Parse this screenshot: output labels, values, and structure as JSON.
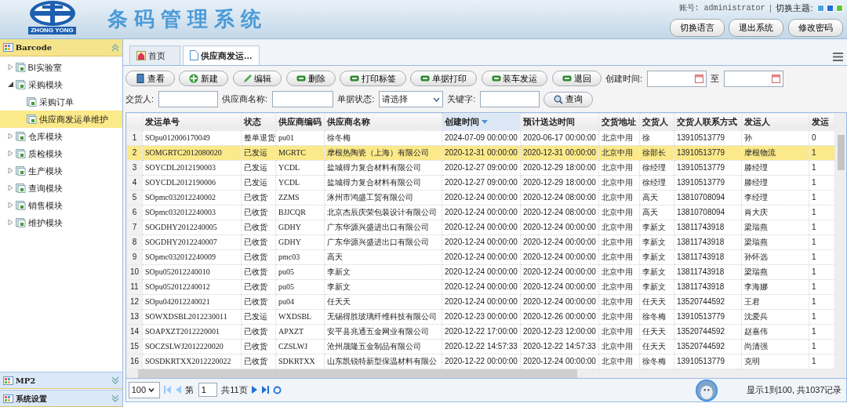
{
  "header": {
    "logo_text": "ZHONG YONG",
    "title": "条码管理系统",
    "account": "账号: administrator",
    "separator": "|",
    "theme_label": "切换主题:",
    "themes": [
      {
        "color": "#4aa3e0"
      },
      {
        "color": "#1e6fd9"
      },
      {
        "color": "#5cc83a"
      }
    ],
    "buttons": [
      "切换语言",
      "退出系统",
      "修改密码"
    ]
  },
  "sidebar": {
    "panels": [
      {
        "title": "Barcode",
        "expanded": true,
        "items": [
          {
            "label": "BI实验室",
            "kind": "folder",
            "expanded": false,
            "selected": false
          },
          {
            "label": "采购模块",
            "kind": "folder",
            "expanded": true,
            "selected": false,
            "children": [
              {
                "label": "采购订单",
                "kind": "leaf",
                "selected": false
              },
              {
                "label": "供应商发运单维护",
                "kind": "leaf",
                "selected": true
              }
            ]
          },
          {
            "label": "仓库模块",
            "kind": "folder",
            "expanded": false,
            "selected": false
          },
          {
            "label": "质检模块",
            "kind": "folder",
            "expanded": false,
            "selected": false
          },
          {
            "label": "生产模块",
            "kind": "folder",
            "expanded": false,
            "selected": false
          },
          {
            "label": "查询模块",
            "kind": "folder",
            "expanded": false,
            "selected": false
          },
          {
            "label": "销售模块",
            "kind": "folder",
            "expanded": false,
            "selected": false
          },
          {
            "label": "维护模块",
            "kind": "folder",
            "expanded": false,
            "selected": false
          }
        ]
      },
      {
        "title": "MP2",
        "expanded": false
      },
      {
        "title": "系统设置",
        "expanded": false
      }
    ]
  },
  "tabs": [
    {
      "label": "首页",
      "kind": "home",
      "selected": false
    },
    {
      "label": "供应商发运…",
      "kind": "page",
      "selected": true
    }
  ],
  "toolbar": {
    "buttons": [
      {
        "label": "查看",
        "kind": "view"
      },
      {
        "label": "新建",
        "kind": "add"
      },
      {
        "label": "编辑",
        "kind": "edit"
      },
      {
        "label": "删除",
        "kind": "bar"
      },
      {
        "label": "打印标签",
        "kind": "bar"
      },
      {
        "label": "单据打印",
        "kind": "bar"
      },
      {
        "label": "装车发运",
        "kind": "bar"
      },
      {
        "label": "退回",
        "kind": "bar"
      }
    ],
    "created_label": "创建时间:",
    "to_label": "至"
  },
  "filters": {
    "deliverer_label": "交货人:",
    "supplier_label": "供应商名称:",
    "status_label": "单据状态:",
    "status_value": "请选择",
    "keyword_label": "关键字:",
    "query_button": "查询"
  },
  "table": {
    "columns": [
      {
        "label": "发运单号",
        "sorted": false
      },
      {
        "label": "状态",
        "sorted": false
      },
      {
        "label": "供应商编码",
        "sorted": false
      },
      {
        "label": "供应商名称",
        "sorted": false
      },
      {
        "label": "创建时间",
        "sorted": true
      },
      {
        "label": "预计送达时间",
        "sorted": false
      },
      {
        "label": "交货地址",
        "sorted": false
      },
      {
        "label": "交货人",
        "sorted": false
      },
      {
        "label": "交货人联系方式",
        "sorted": false
      },
      {
        "label": "发运人",
        "sorted": false
      },
      {
        "label": "发运",
        "sorted": false
      }
    ],
    "rows": [
      {
        "selected": false,
        "number": "1",
        "cells": [
          "SOpu012006170049",
          "整单退货",
          "pu01",
          "徐冬梅",
          "2024-07-09 00:00:00",
          "2020-06-17 00:00:00",
          "北京中用",
          "徐",
          "13910513779",
          "孙",
          "0"
        ]
      },
      {
        "selected": true,
        "number": "2",
        "cells": [
          "SOMGRTC2012080020",
          "已发运",
          "MGRTC",
          "摩根热陶瓷（上海）有限公司",
          "2020-12-31 00:00:00",
          "2020-12-31 00:00:00",
          "北京中用",
          "徐部长",
          "13910513779",
          "摩根物流",
          "1"
        ]
      },
      {
        "selected": false,
        "number": "3",
        "cells": [
          "SOYCDL2012190003",
          "已发运",
          "YCDL",
          "盐城得力复合材料有限公司",
          "2020-12-27 09:00:00",
          "2020-12-29 18:00:00",
          "北京中用",
          "徐经理",
          "13910513779",
          "滕经理",
          "1"
        ]
      },
      {
        "selected": false,
        "number": "4",
        "cells": [
          "SOYCDL2012190006",
          "已发运",
          "YCDL",
          "盐城得力复合材料有限公司",
          "2020-12-27 09:00:00",
          "2020-12-29 18:00:00",
          "北京中用",
          "徐经理",
          "13910513779",
          "滕经理",
          "1"
        ]
      },
      {
        "selected": false,
        "number": "5",
        "cells": [
          "SOpmc032012240002",
          "已收货",
          "ZZMS",
          "涿州市鸿盛工贸有限公司",
          "2020-12-24 00:00:00",
          "2020-12-24 08:00:00",
          "北京中用",
          "高天",
          "13810708094",
          "李经理",
          "1"
        ]
      },
      {
        "selected": false,
        "number": "6",
        "cells": [
          "SOpmc032012240003",
          "已收货",
          "BJJCQR",
          "北京杰辰庆荣包装设计有限公司",
          "2020-12-24 00:00:00",
          "2020-12-24 08:00:00",
          "北京中用",
          "高天",
          "13810708094",
          "肖大庆",
          "1"
        ]
      },
      {
        "selected": false,
        "number": "7",
        "cells": [
          "SOGDHY2012240005",
          "已收货",
          "GDHY",
          "广东华源兴盛进出口有限公司",
          "2020-12-24 00:00:00",
          "2020-12-24 00:00:00",
          "北京中用",
          "李新文",
          "13811743918",
          "梁瑞燕",
          "1"
        ]
      },
      {
        "selected": false,
        "number": "8",
        "cells": [
          "SOGDHY2012240007",
          "已收货",
          "GDHY",
          "广东华源兴盛进出口有限公司",
          "2020-12-24 00:00:00",
          "2020-12-24 00:00:00",
          "北京中用",
          "李新文",
          "13811743918",
          "梁瑞燕",
          "1"
        ]
      },
      {
        "selected": false,
        "number": "9",
        "cells": [
          "SOpmc032012240009",
          "已收货",
          "pmc03",
          "高天",
          "2020-12-24 00:00:00",
          "2020-12-24 00:00:00",
          "北京中用",
          "李新文",
          "13811743918",
          "孙怀选",
          "1"
        ]
      },
      {
        "selected": false,
        "number": "10",
        "cells": [
          "SOpu052012240010",
          "已收货",
          "pu05",
          "李新文",
          "2020-12-24 00:00:00",
          "2020-12-24 00:00:00",
          "北京中用",
          "李新文",
          "13811743918",
          "梁瑞燕",
          "1"
        ]
      },
      {
        "selected": false,
        "number": "11",
        "cells": [
          "SOpu052012240012",
          "已收货",
          "pu05",
          "李新文",
          "2020-12-24 00:00:00",
          "2020-12-24 00:00:00",
          "北京中用",
          "李新文",
          "13811743918",
          "李海娜",
          "1"
        ]
      },
      {
        "selected": false,
        "number": "12",
        "cells": [
          "SOpu042012240021",
          "已收货",
          "pu04",
          "任天天",
          "2020-12-24 00:00:00",
          "2020-12-24 00:00:00",
          "北京中用",
          "任天天",
          "13520744592",
          "王君",
          "1"
        ]
      },
      {
        "selected": false,
        "number": "13",
        "cells": [
          "SOWXDSBL2012230011",
          "已发运",
          "WXDSBL",
          "无锡得胜玻璃纤维科技有限公司",
          "2020-12-23 00:00:00",
          "2020-12-26 00:00:00",
          "北京中用",
          "徐冬梅",
          "13910513779",
          "沈爱兵",
          "1"
        ]
      },
      {
        "selected": false,
        "number": "14",
        "cells": [
          "SOAPXZT2012220001",
          "已收货",
          "APXZT",
          "安平县兆通五金网业有限公司",
          "2020-12-22 17:00:00",
          "2020-12-23 12:00:00",
          "北京中用",
          "任天天",
          "13520744592",
          "赵嘉伟",
          "1"
        ]
      },
      {
        "selected": false,
        "number": "15",
        "cells": [
          "SOCZSLWJ2012220020",
          "已收货",
          "CZSLWJ",
          "沧州晟隆五金制品有限公司",
          "2020-12-22 14:57:33",
          "2020-12-22 14:57:33",
          "北京中用",
          "任天天",
          "13520744592",
          "尚清强",
          "1"
        ]
      },
      {
        "selected": false,
        "number": "16",
        "cells": [
          "SOSDKRTXX2012220022",
          "已收货",
          "SDKRTXX",
          "山东凯锐特新型保温材料有限公",
          "2020-12-22 00:00:00",
          "2020-12-24 00:00:00",
          "北京中用",
          "徐冬梅",
          "13910513779",
          "克明",
          "1"
        ]
      }
    ]
  },
  "pager": {
    "page_size": "100",
    "page_prefix": "第",
    "page": "1",
    "total_pages": "共11页",
    "summary": "显示1到100, 共1037记录"
  }
}
